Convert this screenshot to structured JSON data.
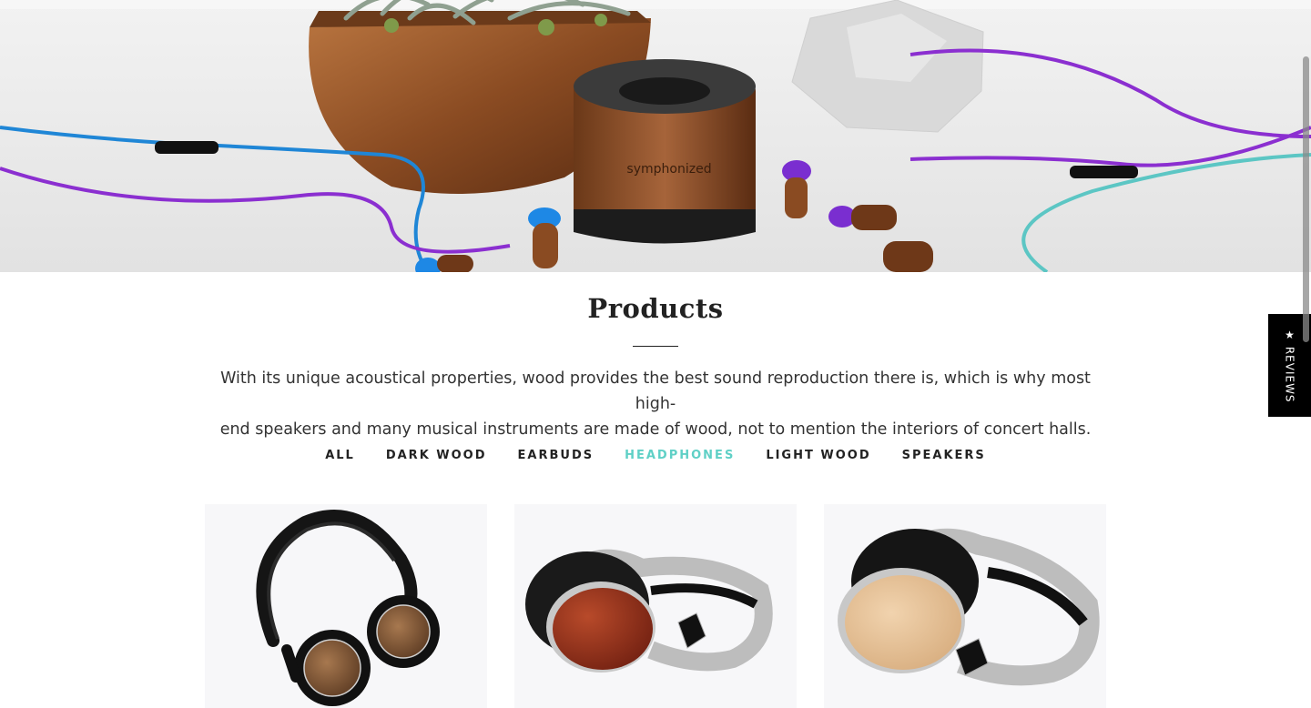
{
  "hero": {
    "brand_text": "symphonized"
  },
  "section": {
    "title": "Products",
    "intro_line1": "With its unique acoustical properties, wood provides the best sound reproduction there is, which is why most high-",
    "intro_line2": "end speakers and many musical instruments are made of wood, not to mention the interiors of concert halls."
  },
  "filters": {
    "items": [
      {
        "label": "ALL"
      },
      {
        "label": "DARK WOOD"
      },
      {
        "label": "EARBUDS"
      },
      {
        "label": "HEADPHONES",
        "active": true
      },
      {
        "label": "LIGHT WOOD"
      },
      {
        "label": "SPEAKERS"
      }
    ],
    "active_color": "#5fd0c6"
  },
  "reviews_tab": {
    "label": "★ REVIEWS"
  },
  "products": [
    {
      "image": "black-walnut-foldable-headphones"
    },
    {
      "image": "rosewood-silver-headphones"
    },
    {
      "image": "maple-silver-headphones"
    }
  ]
}
